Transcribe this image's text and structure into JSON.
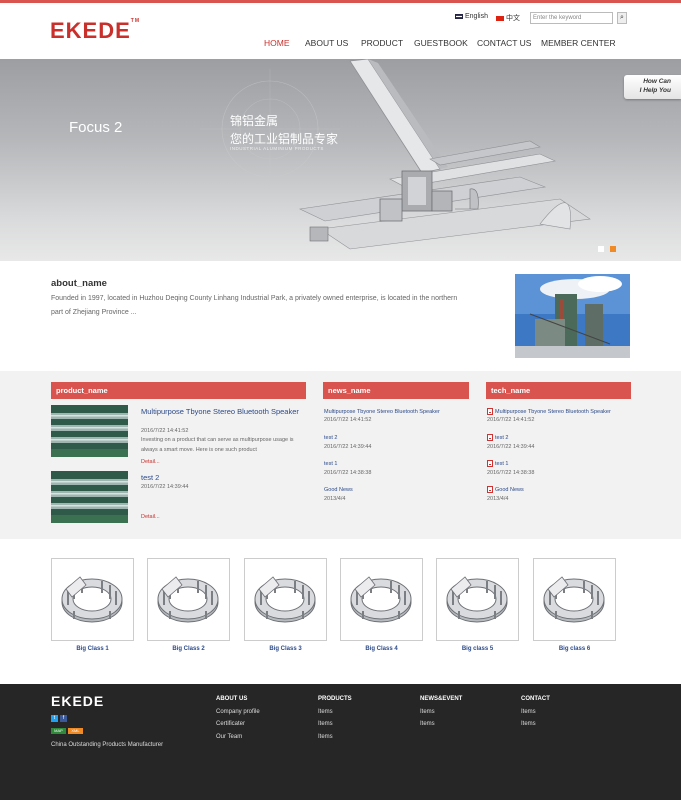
{
  "header": {
    "logo": "EKEDE",
    "logo_tm": "TM",
    "lang_en": "English",
    "lang_cn": "中文",
    "search_placeholder": "Enter the keyword",
    "nav": [
      "HOME",
      "ABOUT US",
      "PRODUCT",
      "GUESTBOOK",
      "CONTACT US",
      "MEMBER CENTER"
    ]
  },
  "banner": {
    "caption": "Focus 2",
    "cn_line1": "锦铝金属",
    "cn_line2": "您的工业铝制品专家",
    "en_line": "INDUSTRIAL ALUMINIUM PRODUCTS",
    "help_line1": "How Can",
    "help_line2": "I Help You"
  },
  "about": {
    "title": "about_name",
    "text": "Founded in 1997, located in Huzhou Deqing County Linhang Industrial Park, a privately owned enterprise, is located in the northern part of Zhejiang Province ..."
  },
  "products": {
    "header": "product_name",
    "items": [
      {
        "title": "Multipurpose Tbyone Stereo Bluetooth Speaker",
        "date": "2016/7/22 14:41:52",
        "desc": "Investing on a product that can serve as multipurpose usage is always a smart move. Here is one such product",
        "detail": "Detail..."
      },
      {
        "title": "test 2",
        "date": "2016/7/22 14:39:44",
        "desc": "",
        "detail": "Detail..."
      }
    ]
  },
  "news": {
    "header": "news_name",
    "items": [
      {
        "title": "Multipurpose Tbyone Stereo Bluetooth Speaker",
        "date": "2016/7/22 14:41:52"
      },
      {
        "title": "test 2",
        "date": "2016/7/22 14:39:44"
      },
      {
        "title": "test 1",
        "date": "2016/7/22 14:38:38"
      },
      {
        "title": "Good News",
        "date": "2013/4/4"
      }
    ]
  },
  "tech": {
    "header": "tech_name",
    "items": [
      {
        "title": "Multipurpose Tbyone Stereo Bluetooth Speaker",
        "date": "2016/7/22 14:41:52"
      },
      {
        "title": "test 2",
        "date": "2016/7/22 14:39:44"
      },
      {
        "title": "test 1",
        "date": "2016/7/22 14:38:38"
      },
      {
        "title": "Good News",
        "date": "2013/4/4"
      }
    ]
  },
  "classes": [
    "Big Class 1",
    "Big Class 2",
    "Big Class 3",
    "Big Class 4",
    "Big class 5",
    "Big class 6"
  ],
  "footer": {
    "logo": "EKEDE",
    "badge_map": "MAP",
    "badge_xml": "XML",
    "tagline": "China Outstanding Products Manufacturer",
    "about_head": "ABOUT US",
    "about_items": [
      "Company profile",
      "Certificater",
      "Our Team"
    ],
    "products_head": "PRODUCTS",
    "products_items": [
      "Items",
      "Items",
      "Items"
    ],
    "news_head": "NEWS&EVENT",
    "news_items": [
      "Items",
      "Items"
    ],
    "contact_head": "CONTACT",
    "contact_items": [
      "Items",
      "Items"
    ]
  },
  "colors": {
    "accent": "#d9534f",
    "link": "#2c4a8a",
    "footer_bg": "#262626"
  }
}
